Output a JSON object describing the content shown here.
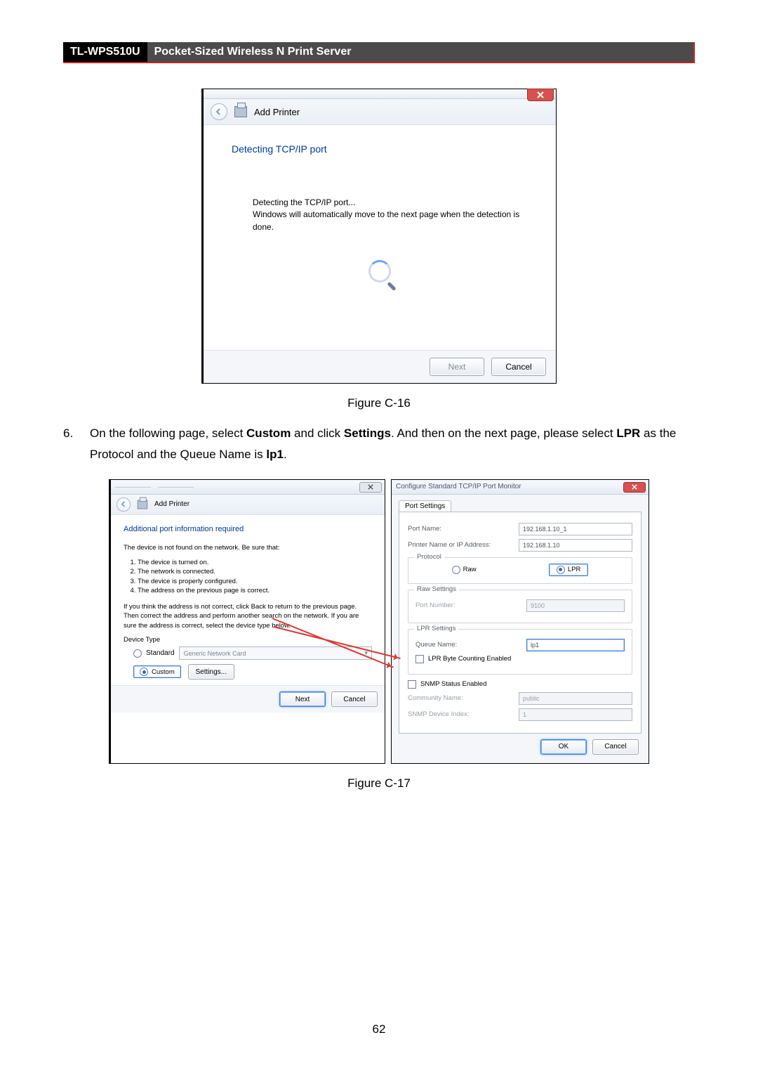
{
  "header": {
    "model": "TL-WPS510U",
    "title": "Pocket-Sized Wireless N Print Server"
  },
  "dialog1": {
    "nav_label": "Add Printer",
    "heading": "Detecting TCP/IP port",
    "line1": "Detecting the TCP/IP port...",
    "line2": "Windows will automatically move to the next page when the detection is done.",
    "next": "Next",
    "cancel": "Cancel"
  },
  "fig1": "Figure C-16",
  "step6": {
    "num": "6.",
    "p1a": "On the following page, select ",
    "p1b": "Custom",
    "p1c": " and click ",
    "p1d": "Settings",
    "p1e": ". And then on the next page, please select ",
    "p1f": "LPR",
    "p1g": " as the Protocol and the Queue Name is ",
    "p1h": "lp1",
    "p1i": "."
  },
  "dialog2": {
    "nav_label": "Add Printer",
    "heading": "Additional port information required",
    "lead": "The device is not found on the network.  Be sure that:",
    "items": [
      "The device is turned on.",
      "The network is connected.",
      "The device is properly configured.",
      "The address on the previous page is correct."
    ],
    "para2": "If you think the address is not correct, click Back to return to the previous page.  Then correct the address and perform another search on the network.  If you are sure the address is correct, select the device type below.",
    "devtype_label": "Device Type",
    "standard": "Standard",
    "standard_combo": "Generic Network Card",
    "custom": "Custom",
    "settings": "Settings...",
    "next": "Next",
    "cancel": "Cancel"
  },
  "dialog3": {
    "title": "Configure Standard TCP/IP Port Monitor",
    "tab": "Port Settings",
    "port_name_l": "Port Name:",
    "port_name_v": "192.168.1.10_1",
    "ip_l": "Printer Name or IP Address:",
    "ip_v": "192.168.1.10",
    "protocol_legend": "Protocol",
    "raw": "Raw",
    "lpr": "LPR",
    "raw_legend": "Raw Settings",
    "raw_port_l": "Port Number:",
    "raw_port_v": "9100",
    "lpr_legend": "LPR Settings",
    "queue_l": "Queue Name:",
    "queue_v": "lp1",
    "lpr_byte": "LPR Byte Counting Enabled",
    "snmp": "SNMP Status Enabled",
    "community_l": "Community Name:",
    "community_v": "public",
    "snmp_idx_l": "SNMP Device Index:",
    "snmp_idx_v": "1",
    "ok": "OK",
    "cancel": "Cancel"
  },
  "fig2": "Figure C-17",
  "page_number": "62"
}
